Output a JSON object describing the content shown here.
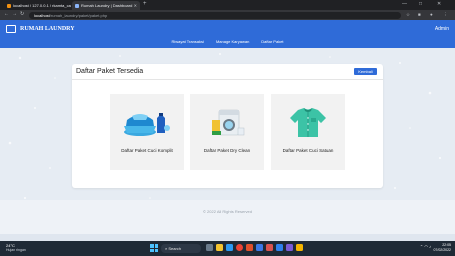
{
  "browser": {
    "tabs": [
      {
        "title": "localhost / 127.0.0.1 / rkamta_ca"
      },
      {
        "title": "Rumah Laundry | Dashboard"
      }
    ],
    "new_tab_symbol": "+",
    "window_controls": [
      "—",
      "□",
      "✕"
    ],
    "url_host": "localhost",
    "url_path": "/rumah_laundry/paket/paket.php"
  },
  "app": {
    "brand": "RUMAH LAUNDRY",
    "user": "Admin",
    "menu": [
      "Riwayat Transaksi",
      "Manage Karyawan",
      "Daftar Paket"
    ]
  },
  "main": {
    "title": "Daftar Paket Tersedia",
    "back_button": "Kembali",
    "packages": [
      {
        "label": "Daftar Paket Cuci Komplit",
        "icon": "laundry-basket-icon"
      },
      {
        "label": "Daftar Paket Dry Clean",
        "icon": "washing-machine-icon"
      },
      {
        "label": "Daftar Paket Cuci Satuan",
        "icon": "shirt-icon"
      }
    ]
  },
  "footer": {
    "copyright": "© 2022 All Rights Reserved"
  },
  "taskbar": {
    "weather_temp": "24°C",
    "weather_text": "Hujan ringan",
    "search_label": "Search",
    "time": "22:05",
    "date": "07/02/2022"
  },
  "colors": {
    "primary": "#2f6bd8",
    "taskbar": "#1f2a36"
  }
}
